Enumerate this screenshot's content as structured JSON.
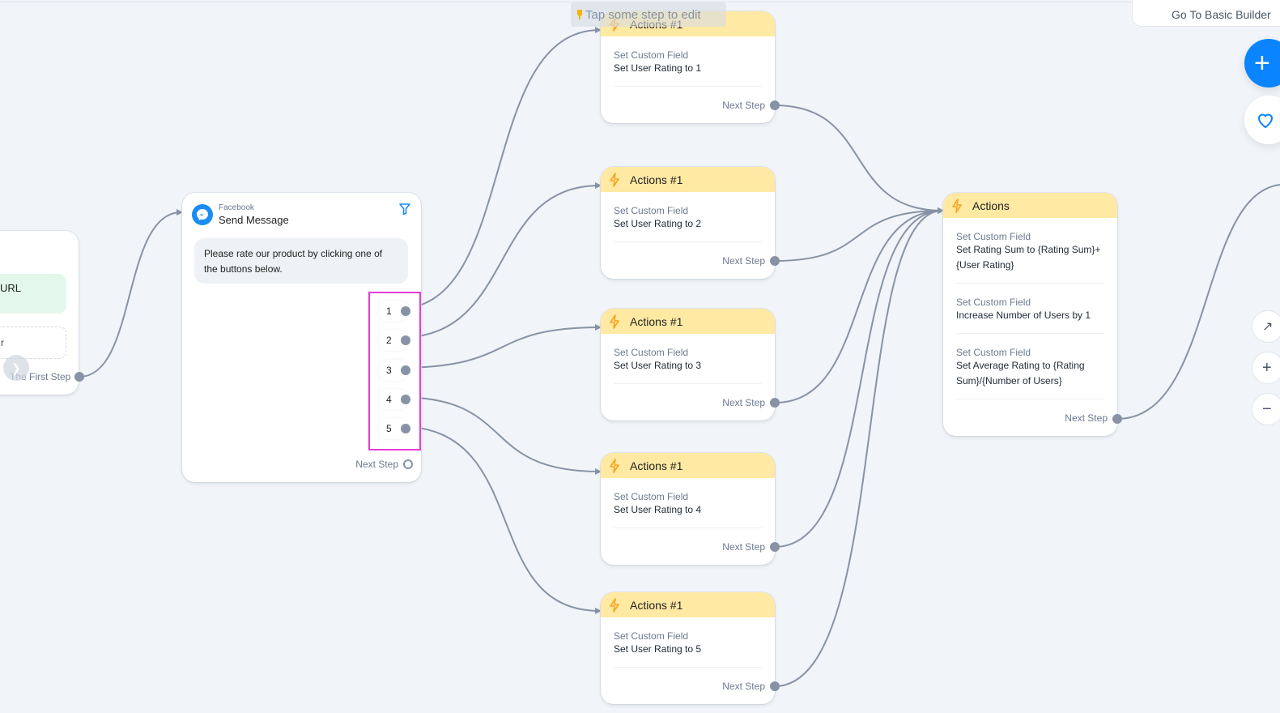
{
  "canvas": {
    "tip_text": "Tap some step to edit",
    "tip_icon": "pointing-hand-icon"
  },
  "toolbar": {
    "basic_builder_label": "Go To Basic Builder",
    "add_button_icon": "plus-icon",
    "favorite_button_icon": "heart-icon",
    "zoom_controls": [
      {
        "name": "magic-wand-button",
        "icon": "wand-icon",
        "glyph": "⚒"
      },
      {
        "name": "zoom-in-button",
        "icon": "plus-icon",
        "glyph": "+"
      },
      {
        "name": "zoom-out-button",
        "icon": "minus-icon",
        "glyph": "−"
      }
    ]
  },
  "first_step": {
    "url_chip": "URL",
    "dashed_chip": "r",
    "next_label": "The First Step"
  },
  "send_message": {
    "channel": "Facebook",
    "title": "Send Message",
    "message": "Please rate our product by clicking one of the buttons below.",
    "buttons": [
      "1",
      "2",
      "3",
      "4",
      "5"
    ],
    "next_label": "Next Step",
    "accent": "#1b8cf2",
    "selection_color": "#e63cd6"
  },
  "rating_actions": [
    {
      "title": "Actions #1",
      "label": "Set Custom Field",
      "value": "Set User Rating to 1",
      "next_label": "Next Step"
    },
    {
      "title": "Actions #1",
      "label": "Set Custom Field",
      "value": "Set User Rating to 2",
      "next_label": "Next Step"
    },
    {
      "title": "Actions #1",
      "label": "Set Custom Field",
      "value": "Set User Rating to 3",
      "next_label": "Next Step"
    },
    {
      "title": "Actions #1",
      "label": "Set Custom Field",
      "value": "Set User Rating to 4",
      "next_label": "Next Step"
    },
    {
      "title": "Actions #1",
      "label": "Set Custom Field",
      "value": "Set User Rating to 5",
      "next_label": "Next Step"
    }
  ],
  "summary_actions": {
    "title": "Actions",
    "rows": [
      {
        "label": "Set Custom Field",
        "value": "Set Rating Sum to {Rating Sum}+{User Rating}"
      },
      {
        "label": "Set Custom Field",
        "value": "Increase Number of Users by 1"
      },
      {
        "label": "Set Custom Field",
        "value": "Set Average Rating to {Rating Sum}/{Number of Users}"
      }
    ],
    "next_label": "Next Step"
  },
  "colors": {
    "canvas_bg": "#f1f4f8",
    "action_header": "#ffe9a3",
    "wire": "#8793a5",
    "fab_blue": "#0a84ff"
  }
}
